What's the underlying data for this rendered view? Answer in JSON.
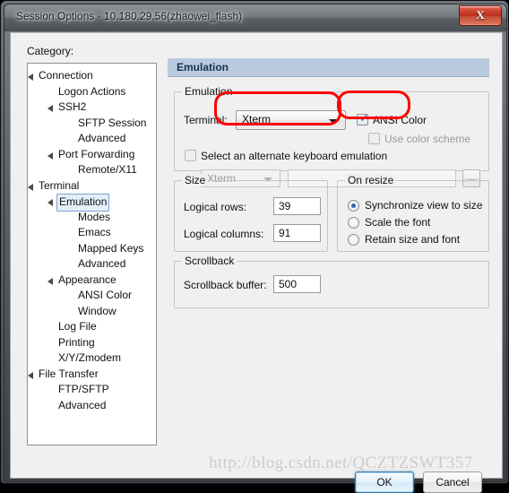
{
  "window": {
    "title": "Session Options - 10.180.29.56(zhaowei_flash)",
    "close_icon": "X",
    "accent_red": "#fe0000",
    "header_blue": "#b9cade"
  },
  "sidebar": {
    "label": "Category:",
    "items": [
      {
        "label": "Connection",
        "indent": 0,
        "arrow": true,
        "selected": false
      },
      {
        "label": "Logon Actions",
        "indent": 1,
        "arrow": false,
        "selected": false
      },
      {
        "label": "SSH2",
        "indent": 1,
        "arrow": true,
        "selected": false
      },
      {
        "label": "SFTP Session",
        "indent": 2,
        "arrow": false,
        "selected": false
      },
      {
        "label": "Advanced",
        "indent": 2,
        "arrow": false,
        "selected": false
      },
      {
        "label": "Port Forwarding",
        "indent": 1,
        "arrow": true,
        "selected": false
      },
      {
        "label": "Remote/X11",
        "indent": 2,
        "arrow": false,
        "selected": false
      },
      {
        "label": "Terminal",
        "indent": 0,
        "arrow": true,
        "selected": false
      },
      {
        "label": "Emulation",
        "indent": 1,
        "arrow": true,
        "selected": true
      },
      {
        "label": "Modes",
        "indent": 2,
        "arrow": false,
        "selected": false
      },
      {
        "label": "Emacs",
        "indent": 2,
        "arrow": false,
        "selected": false
      },
      {
        "label": "Mapped Keys",
        "indent": 2,
        "arrow": false,
        "selected": false
      },
      {
        "label": "Advanced",
        "indent": 2,
        "arrow": false,
        "selected": false
      },
      {
        "label": "Appearance",
        "indent": 1,
        "arrow": true,
        "selected": false
      },
      {
        "label": "ANSI Color",
        "indent": 2,
        "arrow": false,
        "selected": false
      },
      {
        "label": "Window",
        "indent": 2,
        "arrow": false,
        "selected": false
      },
      {
        "label": "Log File",
        "indent": 1,
        "arrow": false,
        "selected": false
      },
      {
        "label": "Printing",
        "indent": 1,
        "arrow": false,
        "selected": false
      },
      {
        "label": "X/Y/Zmodem",
        "indent": 1,
        "arrow": false,
        "selected": false
      },
      {
        "label": "File Transfer",
        "indent": 0,
        "arrow": true,
        "selected": false
      },
      {
        "label": "FTP/SFTP",
        "indent": 1,
        "arrow": false,
        "selected": false
      },
      {
        "label": "Advanced",
        "indent": 1,
        "arrow": false,
        "selected": false
      }
    ]
  },
  "pane": {
    "header": "Emulation",
    "emulation_group": {
      "legend": "Emulation",
      "terminal_label": "Terminal:",
      "terminal_value": "Xterm",
      "ansi_color_label": "ANSI Color",
      "ansi_color_checked": true,
      "use_color_scheme_label": "Use color scheme",
      "use_color_scheme_checked": false,
      "alternate_kb_label": "Select an alternate keyboard emulation",
      "alternate_kb_checked": false,
      "alternate_kb_value": "Xterm",
      "alternate_kb_file": "",
      "browse_label": "..."
    },
    "size_group": {
      "legend": "Size",
      "rows_label": "Logical rows:",
      "rows_value": "39",
      "cols_label": "Logical columns:",
      "cols_value": "91"
    },
    "resize_group": {
      "legend": "On resize",
      "options": [
        {
          "label": "Synchronize view to size",
          "selected": true
        },
        {
          "label": "Scale the font",
          "selected": false
        },
        {
          "label": "Retain size and font",
          "selected": false
        }
      ]
    },
    "scrollback_group": {
      "legend": "Scrollback",
      "buffer_label": "Scrollback buffer:",
      "buffer_value": "500"
    }
  },
  "footer": {
    "ok_label": "OK",
    "cancel_label": "Cancel"
  },
  "watermark": "http://blog.csdn.net/QCZTZSWT357"
}
